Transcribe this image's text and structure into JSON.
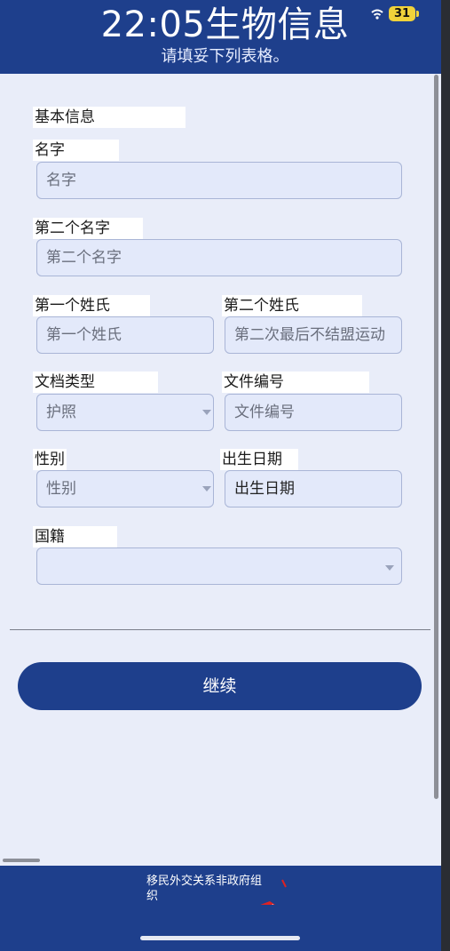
{
  "header": {
    "title": "22:05生物信息",
    "subtitle": "请填妥下列表格。",
    "battery": "31",
    "color": "#1e3f8c"
  },
  "form": {
    "section_title": "基本信息",
    "name": {
      "label": "名字",
      "placeholder": "名字"
    },
    "middle_name": {
      "label": "第二个名字",
      "placeholder": "第二个名字"
    },
    "first_surname": {
      "label": "第一个姓氏",
      "placeholder": "第一个姓氏"
    },
    "second_surname": {
      "label": "第二个姓氏",
      "placeholder": "第二次最后不结盟运动"
    },
    "document_type": {
      "label": "文档类型",
      "value": "护照"
    },
    "document_number": {
      "label": "文件编号",
      "placeholder": "文件编号"
    },
    "gender": {
      "label": "性别",
      "value": "性别"
    },
    "birth_date": {
      "label": "出生日期",
      "placeholder": "出生日期"
    },
    "nationality": {
      "label": "国籍",
      "value": ""
    }
  },
  "continue_label": "继续",
  "footer": {
    "org_line1": "移民外交关系非政府组",
    "org_line2": "织"
  }
}
